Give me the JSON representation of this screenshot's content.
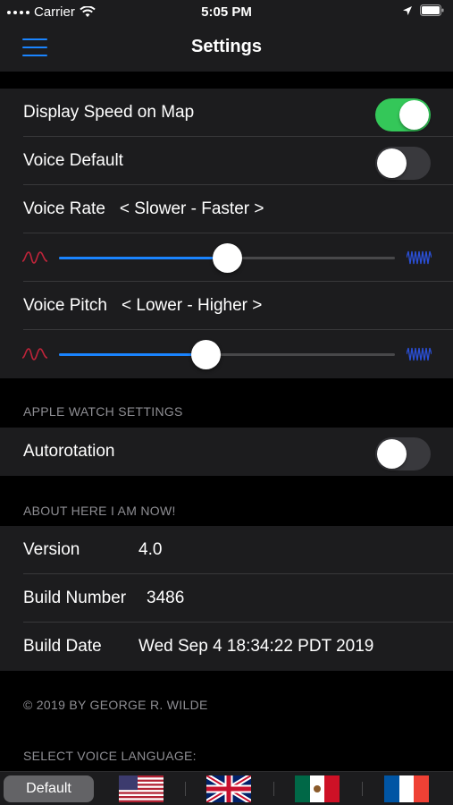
{
  "status": {
    "carrier": "Carrier",
    "time": "5:05 PM",
    "icons": [
      "signal-dots",
      "wifi-icon",
      "location-arrow-icon",
      "battery-icon"
    ]
  },
  "nav": {
    "title": "Settings",
    "menu_icon": "hamburger-menu-icon"
  },
  "settings": {
    "display_speed": {
      "label": "Display Speed on Map",
      "on": true
    },
    "voice_default": {
      "label": "Voice Default",
      "on": false
    },
    "voice_rate": {
      "label": "Voice Rate",
      "hint": "< Slower - Faster >",
      "value": 0.5
    },
    "voice_pitch": {
      "label": "Voice Pitch",
      "hint": "< Lower - Higher >",
      "value": 0.435
    }
  },
  "watch": {
    "header": "APPLE WATCH SETTINGS",
    "autorotation": {
      "label": "Autorotation",
      "on": false
    }
  },
  "about": {
    "header": "ABOUT HERE I AM NOW!",
    "version_label": "Version",
    "version_value": "4.0",
    "build_number_label": "Build Number",
    "build_number_value": "3486",
    "build_date_label": "Build Date",
    "build_date_value": "Wed Sep 4 18:34:22 PDT 2019"
  },
  "copyright": "© 2019 BY GEORGE R. WILDE",
  "voice_language": {
    "header": "SELECT VOICE LANGUAGE:",
    "selected": "Default",
    "options": [
      "Default",
      "us-flag",
      "uk-flag",
      "mexico-flag",
      "france-flag"
    ]
  },
  "colors": {
    "accent": "#1a84ff",
    "toggle_on": "#34c759",
    "low_wave": "#c0243a",
    "high_wave": "#2a4fd6",
    "background": "#000000",
    "cell": "#1c1c1e"
  }
}
